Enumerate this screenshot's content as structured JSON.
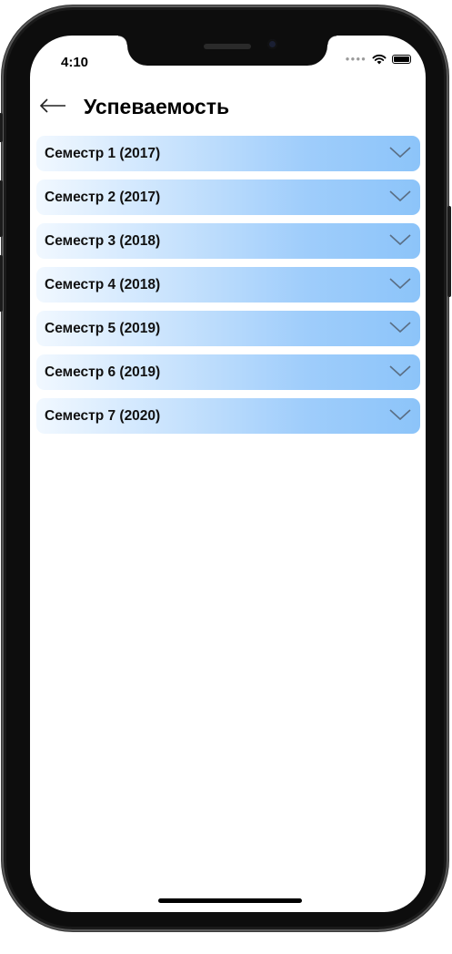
{
  "status_bar": {
    "time": "4:10",
    "signal_icon": "signal-dots-icon",
    "wifi_icon": "wifi-icon",
    "battery_icon": "battery-icon"
  },
  "header": {
    "back_icon": "arrow-left-icon",
    "title": "Успеваемость"
  },
  "semesters": [
    {
      "label": "Семестр 1 (2017)",
      "icon": "chevron-down-icon"
    },
    {
      "label": "Семестр 2 (2017)",
      "icon": "chevron-down-icon"
    },
    {
      "label": "Семестр 3 (2018)",
      "icon": "chevron-down-icon"
    },
    {
      "label": "Семестр 4 (2018)",
      "icon": "chevron-down-icon"
    },
    {
      "label": "Семестр 5 (2019)",
      "icon": "chevron-down-icon"
    },
    {
      "label": "Семестр 6 (2019)",
      "icon": "chevron-down-icon"
    },
    {
      "label": "Семестр 7 (2020)",
      "icon": "chevron-down-icon"
    }
  ],
  "colors": {
    "item_gradient_start": "#f1f8ff",
    "item_gradient_end": "#8cc4f9",
    "chevron": "#5a6e84"
  }
}
